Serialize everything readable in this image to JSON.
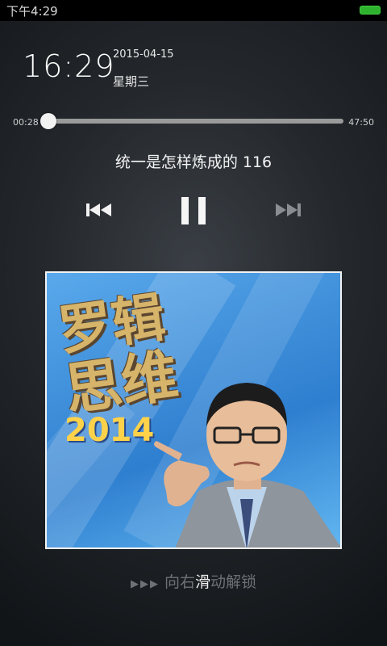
{
  "status_bar": {
    "time": "下午4:29"
  },
  "lockscreen": {
    "clock": "16:29",
    "date": "2015-04-15",
    "weekday": "星期三"
  },
  "player": {
    "elapsed": "00:28",
    "total": "47:50",
    "progress_fraction": 0.01,
    "track_title": "统一是怎样炼成的 116",
    "controls": {
      "prev": "previous-icon",
      "pause": "pause-icon",
      "next": "next-icon"
    }
  },
  "album_cover": {
    "logo_line1": "罗辑",
    "logo_line2": "思维",
    "year": "2014"
  },
  "unlock_hint": {
    "arrows": "▶▶▶",
    "text_before": "向右",
    "text_highlight": "滑",
    "text_after": "动解锁"
  }
}
